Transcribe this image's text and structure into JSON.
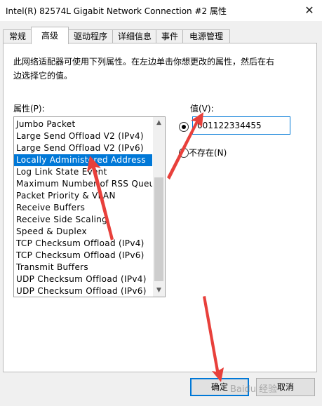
{
  "window": {
    "title": "Intel(R) 82574L Gigabit Network Connection #2 属性",
    "close_icon": "close-icon"
  },
  "tabs": [
    {
      "label": "常规",
      "active": false
    },
    {
      "label": "高级",
      "active": true
    },
    {
      "label": "驱动程序",
      "active": false
    },
    {
      "label": "详细信息",
      "active": false
    },
    {
      "label": "事件",
      "active": false
    },
    {
      "label": "电源管理",
      "active": false
    }
  ],
  "advanced": {
    "description": "此网络适配器可使用下列属性。在左边单击你想更改的属性，然后在右边选择它的值。",
    "property_label": "属性(P):",
    "properties": [
      "Jumbo Packet",
      "Large Send Offload V2 (IPv4)",
      "Large Send Offload V2 (IPv6)",
      "Locally Administered Address",
      "Log Link State Event",
      "Maximum Number of RSS Queue",
      "Packet Priority & VLAN",
      "Receive Buffers",
      "Receive Side Scaling",
      "Speed & Duplex",
      "TCP Checksum Offload (IPv4)",
      "TCP Checksum Offload (IPv6)",
      "Transmit Buffers",
      "UDP Checksum Offload (IPv4)",
      "UDP Checksum Offload (IPv6)"
    ],
    "selected_index": 3,
    "value_label": "值(V):",
    "value_input": "001122334455",
    "value_radio_selected": true,
    "not_present_label": "不存在(N)",
    "not_present_selected": false
  },
  "buttons": {
    "ok": "确定",
    "cancel": "取消"
  },
  "annotation_color": "#e8403b",
  "watermark": "Baidu 经验"
}
